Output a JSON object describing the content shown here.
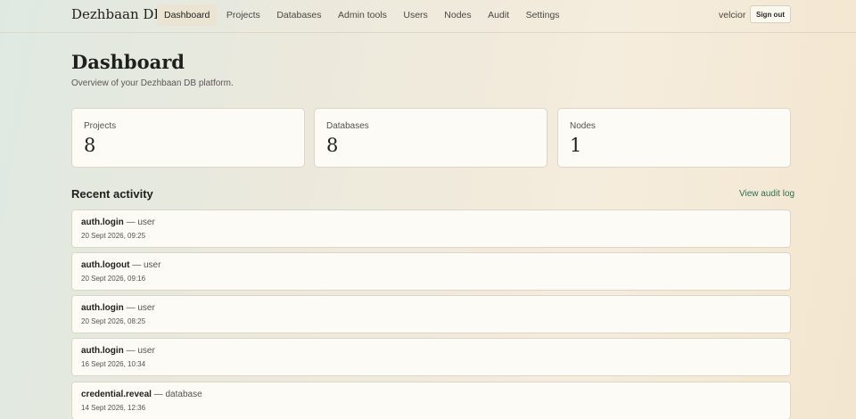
{
  "brand": "Dezhbaan DB",
  "nav": [
    {
      "label": "Dashboard",
      "active": true
    },
    {
      "label": "Projects"
    },
    {
      "label": "Databases"
    },
    {
      "label": "Admin tools"
    },
    {
      "label": "Users"
    },
    {
      "label": "Nodes"
    },
    {
      "label": "Audit"
    },
    {
      "label": "Settings"
    }
  ],
  "user": {
    "name": "velcior",
    "signout_label": "Sign out"
  },
  "page": {
    "title": "Dashboard",
    "subtitle": "Overview of your Dezhbaan DB platform."
  },
  "stats": [
    {
      "label": "Projects",
      "value": "8"
    },
    {
      "label": "Databases",
      "value": "8"
    },
    {
      "label": "Nodes",
      "value": "1"
    }
  ],
  "activity": {
    "title": "Recent activity",
    "link_label": "View audit log",
    "items": [
      {
        "event": "auth.login",
        "sep": "—",
        "actor": "user",
        "time": "20 Sept 2026, 09:25"
      },
      {
        "event": "auth.logout",
        "sep": "—",
        "actor": "user",
        "time": "20 Sept 2026, 09:16"
      },
      {
        "event": "auth.login",
        "sep": "—",
        "actor": "user",
        "time": "20 Sept 2026, 08:25"
      },
      {
        "event": "auth.login",
        "sep": "—",
        "actor": "user",
        "time": "16 Sept 2026, 10:34"
      },
      {
        "event": "credential.reveal",
        "sep": "—",
        "actor": "database",
        "time": "14 Sept 2026, 12:36"
      }
    ]
  },
  "colors": {
    "accent_link": "#2e6e52",
    "active_nav_bg": "#ece4d2",
    "card_bg": "#fdfbf6"
  }
}
